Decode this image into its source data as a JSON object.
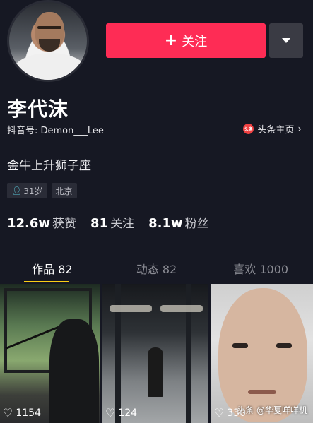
{
  "header": {
    "follow_label": "关注",
    "follow_icon": "+",
    "more_icon": "chevron-down-icon"
  },
  "profile": {
    "name": "李代沫",
    "douyin_id": "抖音号: Demon___Lee",
    "toutiao_icon_text": "头条",
    "toutiao_label": "头条主页",
    "bio": "金牛上升狮子座",
    "tags": {
      "age": "31岁",
      "city": "北京"
    }
  },
  "stats": [
    {
      "num": "12.6w",
      "label": "获赞"
    },
    {
      "num": "81",
      "label": "关注"
    },
    {
      "num": "8.1w",
      "label": "粉丝"
    }
  ],
  "tabs": [
    {
      "label": "作品 82",
      "active": true
    },
    {
      "label": "动态 82",
      "active": false
    },
    {
      "label": "喜欢 1000",
      "active": false
    }
  ],
  "videos": [
    {
      "likes": "1154"
    },
    {
      "likes": "124"
    },
    {
      "likes": "330"
    }
  ],
  "watermark": "头条 @华夏咩咩机",
  "colors": {
    "background": "#161823",
    "accent": "#fe2c55",
    "tab_indicator": "#face15"
  }
}
